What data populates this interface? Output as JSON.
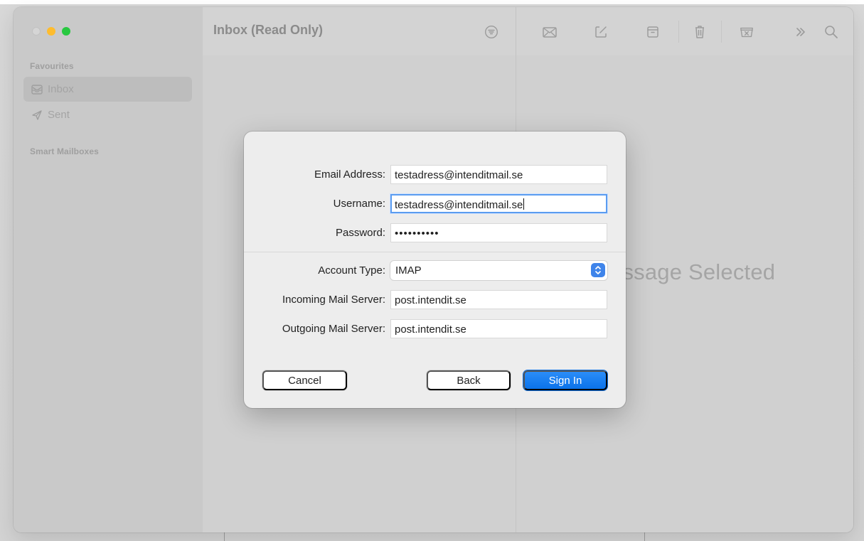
{
  "window": {
    "traffic_lights": {
      "close_color": "#d5d5d5",
      "minimize_color": "#febc2e",
      "maximize_color": "#28c840"
    }
  },
  "sidebar": {
    "favourites_heading": "Favourites",
    "items": [
      {
        "label": "Inbox",
        "icon": "inbox-icon",
        "selected": true
      },
      {
        "label": "Sent",
        "icon": "paper-plane-icon",
        "selected": false
      }
    ],
    "smart_mailboxes_heading": "Smart Mailboxes"
  },
  "message_list": {
    "title": "Inbox (Read Only)",
    "filter_icon": "filter-icon"
  },
  "message_view": {
    "toolbar_icons": [
      "envelope-icon",
      "compose-icon",
      "archive-icon",
      "trash-icon",
      "junk-icon",
      "more-icon",
      "search-icon"
    ],
    "empty_state_text": "essage Selected"
  },
  "dialog": {
    "fields": {
      "email": {
        "label": "Email Address:",
        "value": "testadress@intenditmail.se"
      },
      "username": {
        "label": "Username:",
        "value": "testadress@intenditmail.se"
      },
      "password": {
        "label": "Password:",
        "value": "••••••••••"
      },
      "account_type": {
        "label": "Account Type:",
        "value": "IMAP"
      },
      "incoming_server": {
        "label": "Incoming Mail Server:",
        "value": "post.intendit.se"
      },
      "outgoing_server": {
        "label": "Outgoing Mail Server:",
        "value": "post.intendit.se"
      }
    },
    "buttons": {
      "cancel": "Cancel",
      "back": "Back",
      "sign_in": "Sign In"
    },
    "accent_color": "#0a72ea"
  }
}
